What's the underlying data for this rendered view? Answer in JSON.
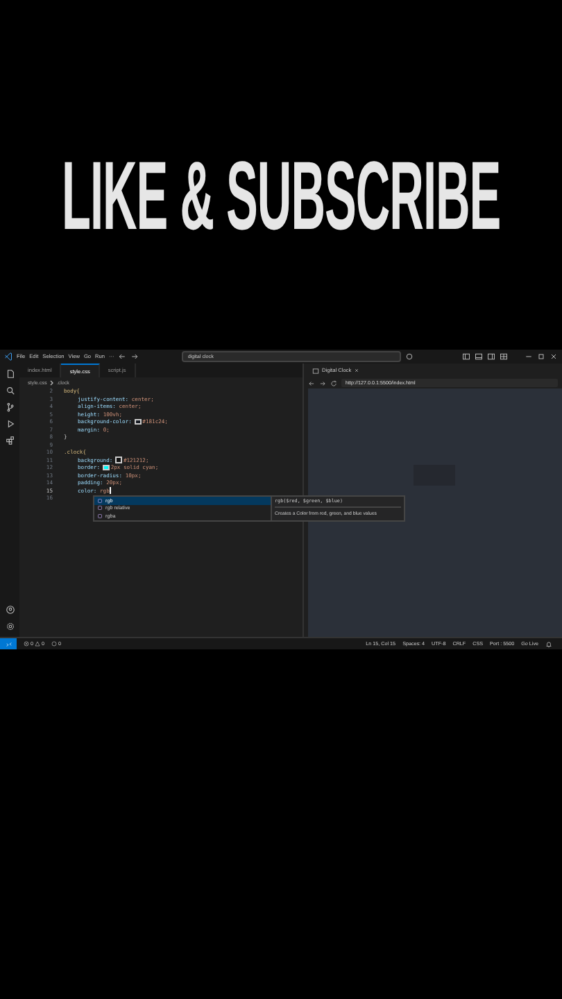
{
  "headline": "LIKE & SUBSCRIBE",
  "menu": [
    "File",
    "Edit",
    "Selection",
    "View",
    "Go",
    "Run",
    "···"
  ],
  "search": {
    "value": "digital clock"
  },
  "editor_tabs": [
    {
      "label": "index.html",
      "selected": false
    },
    {
      "label": "style.css",
      "selected": true
    },
    {
      "label": "script.js",
      "selected": false
    }
  ],
  "breadcrumb": [
    "style.css",
    ".clock"
  ],
  "code_lines": [
    {
      "number": "2",
      "kind": "selector",
      "text": "body{"
    },
    {
      "number": "3",
      "kind": "declaration",
      "property": "justify-content:",
      "value": "center;"
    },
    {
      "number": "4",
      "kind": "declaration",
      "property": "align-items:",
      "value": "center;"
    },
    {
      "number": "5",
      "kind": "declaration",
      "property": "height:",
      "value": "100vh;"
    },
    {
      "number": "6",
      "kind": "declaration",
      "property": "background-color:",
      "value": "#181c24;",
      "color": "#181c24"
    },
    {
      "number": "7",
      "kind": "declaration",
      "property": "margin:",
      "value": "0;"
    },
    {
      "number": "8",
      "kind": "close",
      "text": "}"
    },
    {
      "number": "9",
      "kind": "blank"
    },
    {
      "number": "10",
      "kind": "selector",
      "text": ".clock{"
    },
    {
      "number": "11",
      "kind": "declaration",
      "property": "background:",
      "value": "#121212;",
      "color": "#121212"
    },
    {
      "number": "12",
      "kind": "declaration",
      "property": "border:",
      "value": "2px solid cyan;",
      "color": "#00ffff"
    },
    {
      "number": "13",
      "kind": "declaration",
      "property": "border-radius:",
      "value": "10px;"
    },
    {
      "number": "14",
      "kind": "declaration",
      "property": "padding:",
      "value": "20px;"
    },
    {
      "number": "15",
      "kind": "declaration",
      "property": "color:",
      "value": "rgb",
      "current": true
    },
    {
      "number": "16",
      "kind": "blank"
    }
  ],
  "suggestions": [
    {
      "label": "rgb",
      "selected": true
    },
    {
      "label": "rgb relative",
      "selected": false
    },
    {
      "label": "rgba",
      "selected": false
    }
  ],
  "suggestion_detail": {
    "signature": "rgb($red, $green, $blue)",
    "description": "Creates a Color from red, green, and blue values"
  },
  "browser": {
    "tab": "Digital Clock",
    "url": "http://127.0.0.1:5500/index.html"
  },
  "status_bar": {
    "problems": [
      "0",
      "0"
    ],
    "ports": "0",
    "items": [
      "Ln 15, Col 15",
      "Spaces: 4",
      "UTF-8",
      "CRLF",
      "CSS",
      "Port : 5500",
      "Go Live"
    ]
  }
}
